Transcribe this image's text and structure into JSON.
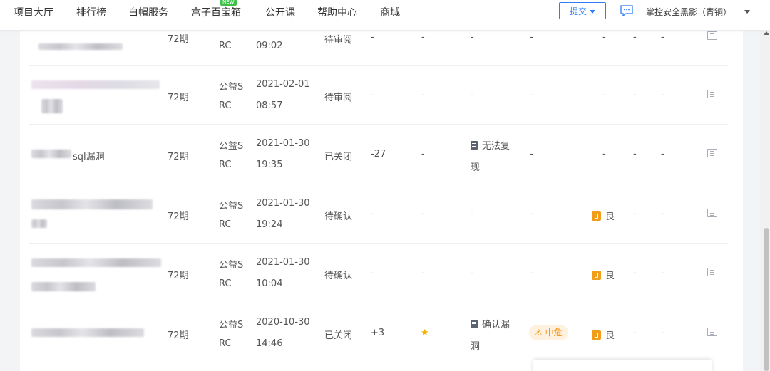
{
  "nav": {
    "items": [
      "项目大厅",
      "排行榜",
      "白帽服务",
      "盒子百宝箱",
      "公开课",
      "帮助中心",
      "商城"
    ],
    "new_badge": "NEW",
    "submit_label": "提交",
    "user_name": "掌控安全黑影（青铜）"
  },
  "rows": [
    {
      "title": "",
      "period": "72期",
      "project_line1": "",
      "project_line2": "RC",
      "date_line1": "",
      "date_line2": "09:02",
      "status": "待审阅",
      "score": "-",
      "col_star": "-",
      "review_line1": "-",
      "review_line2": "",
      "severity": "-",
      "rating": "-",
      "col_a": "-",
      "col_b": "-"
    },
    {
      "title": "",
      "period": "72期",
      "project_line1": "公益S",
      "project_line2": "RC",
      "date_line1": "2021-02-01",
      "date_line2": "08:57",
      "status": "待审阅",
      "score": "-",
      "col_star": "-",
      "review_line1": "-",
      "review_line2": "",
      "severity": "-",
      "rating": "-",
      "col_a": "-",
      "col_b": "-"
    },
    {
      "title": "sql漏洞",
      "period": "72期",
      "project_line1": "公益S",
      "project_line2": "RC",
      "date_line1": "2021-01-30",
      "date_line2": "19:35",
      "status": "已关闭",
      "score": "-27",
      "col_star": "-",
      "review_line1": "无法复",
      "review_line2": "现",
      "severity": "-",
      "rating": "-",
      "col_a": "-",
      "col_b": "-"
    },
    {
      "title": "",
      "period": "72期",
      "project_line1": "公益S",
      "project_line2": "RC",
      "date_line1": "2021-01-30",
      "date_line2": "19:24",
      "status": "待确认",
      "score": "-",
      "col_star": "-",
      "review_line1": "-",
      "review_line2": "",
      "severity": "-",
      "rating": "良",
      "col_a": "-",
      "col_b": "-"
    },
    {
      "title": "",
      "period": "72期",
      "project_line1": "公益S",
      "project_line2": "RC",
      "date_line1": "2021-01-30",
      "date_line2": "10:04",
      "status": "待确认",
      "score": "-",
      "col_star": "-",
      "review_line1": "-",
      "review_line2": "",
      "severity": "-",
      "rating": "良",
      "col_a": "-",
      "col_b": "-"
    },
    {
      "title": "",
      "period": "72期",
      "project_line1": "公益S",
      "project_line2": "RC",
      "date_line1": "2020-10-30",
      "date_line2": "14:46",
      "status": "已关闭",
      "score": "+3",
      "col_star": "★",
      "review_line1": "确认漏",
      "review_line2": "洞",
      "severity": "中危",
      "rating": "良",
      "col_a": "-",
      "col_b": "-"
    }
  ],
  "colors": {
    "accent": "#2f7cf6",
    "new_badge": "#3fc04b",
    "severity_medium": "#f08c00",
    "rating_badge": "#f29d1a",
    "star": "#f5b400"
  }
}
